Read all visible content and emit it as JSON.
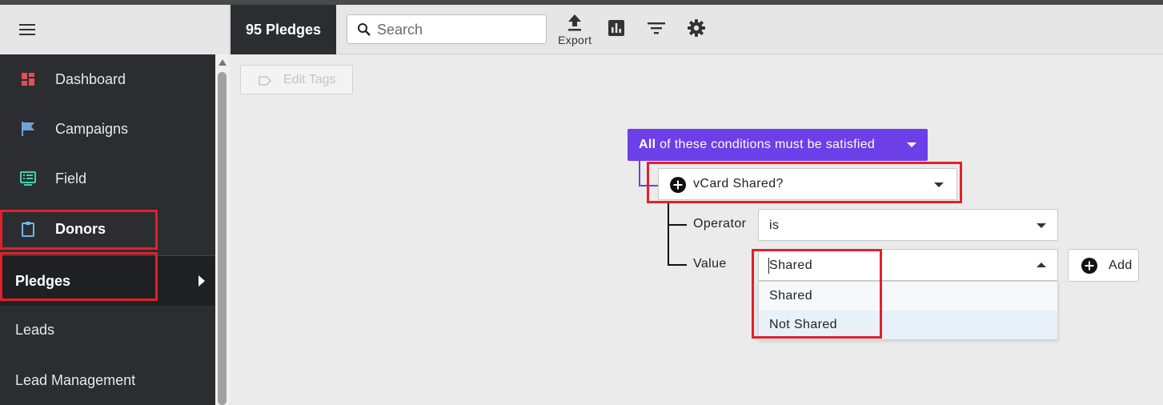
{
  "sidebar": {
    "items": [
      {
        "label": "Dashboard",
        "icon": "dashboard-icon"
      },
      {
        "label": "Campaigns",
        "icon": "flag-icon"
      },
      {
        "label": "Field",
        "icon": "field-icon"
      },
      {
        "label": "Donors",
        "icon": "clipboard-icon"
      }
    ],
    "sub_items": [
      {
        "label": "Pledges",
        "active": true
      },
      {
        "label": "Leads"
      },
      {
        "label": "Lead Management"
      }
    ]
  },
  "topbar": {
    "count_label": "95 Pledges",
    "search_placeholder": "Search",
    "export_label": "Export"
  },
  "toolbar": {
    "edit_tags_label": "Edit Tags"
  },
  "filter": {
    "condition_bold": "All",
    "condition_rest": " of these conditions must be satisfied",
    "field_value": "vCard Shared?",
    "operator_label": "Operator",
    "operator_value": "is",
    "value_label": "Value",
    "value_current": "Shared",
    "value_options": [
      "Shared",
      "Not Shared"
    ],
    "add_label": "Add"
  },
  "colors": {
    "accent": "#6c3fe8",
    "sidebar_bg": "#2b2d31",
    "highlight": "#e3202a"
  }
}
